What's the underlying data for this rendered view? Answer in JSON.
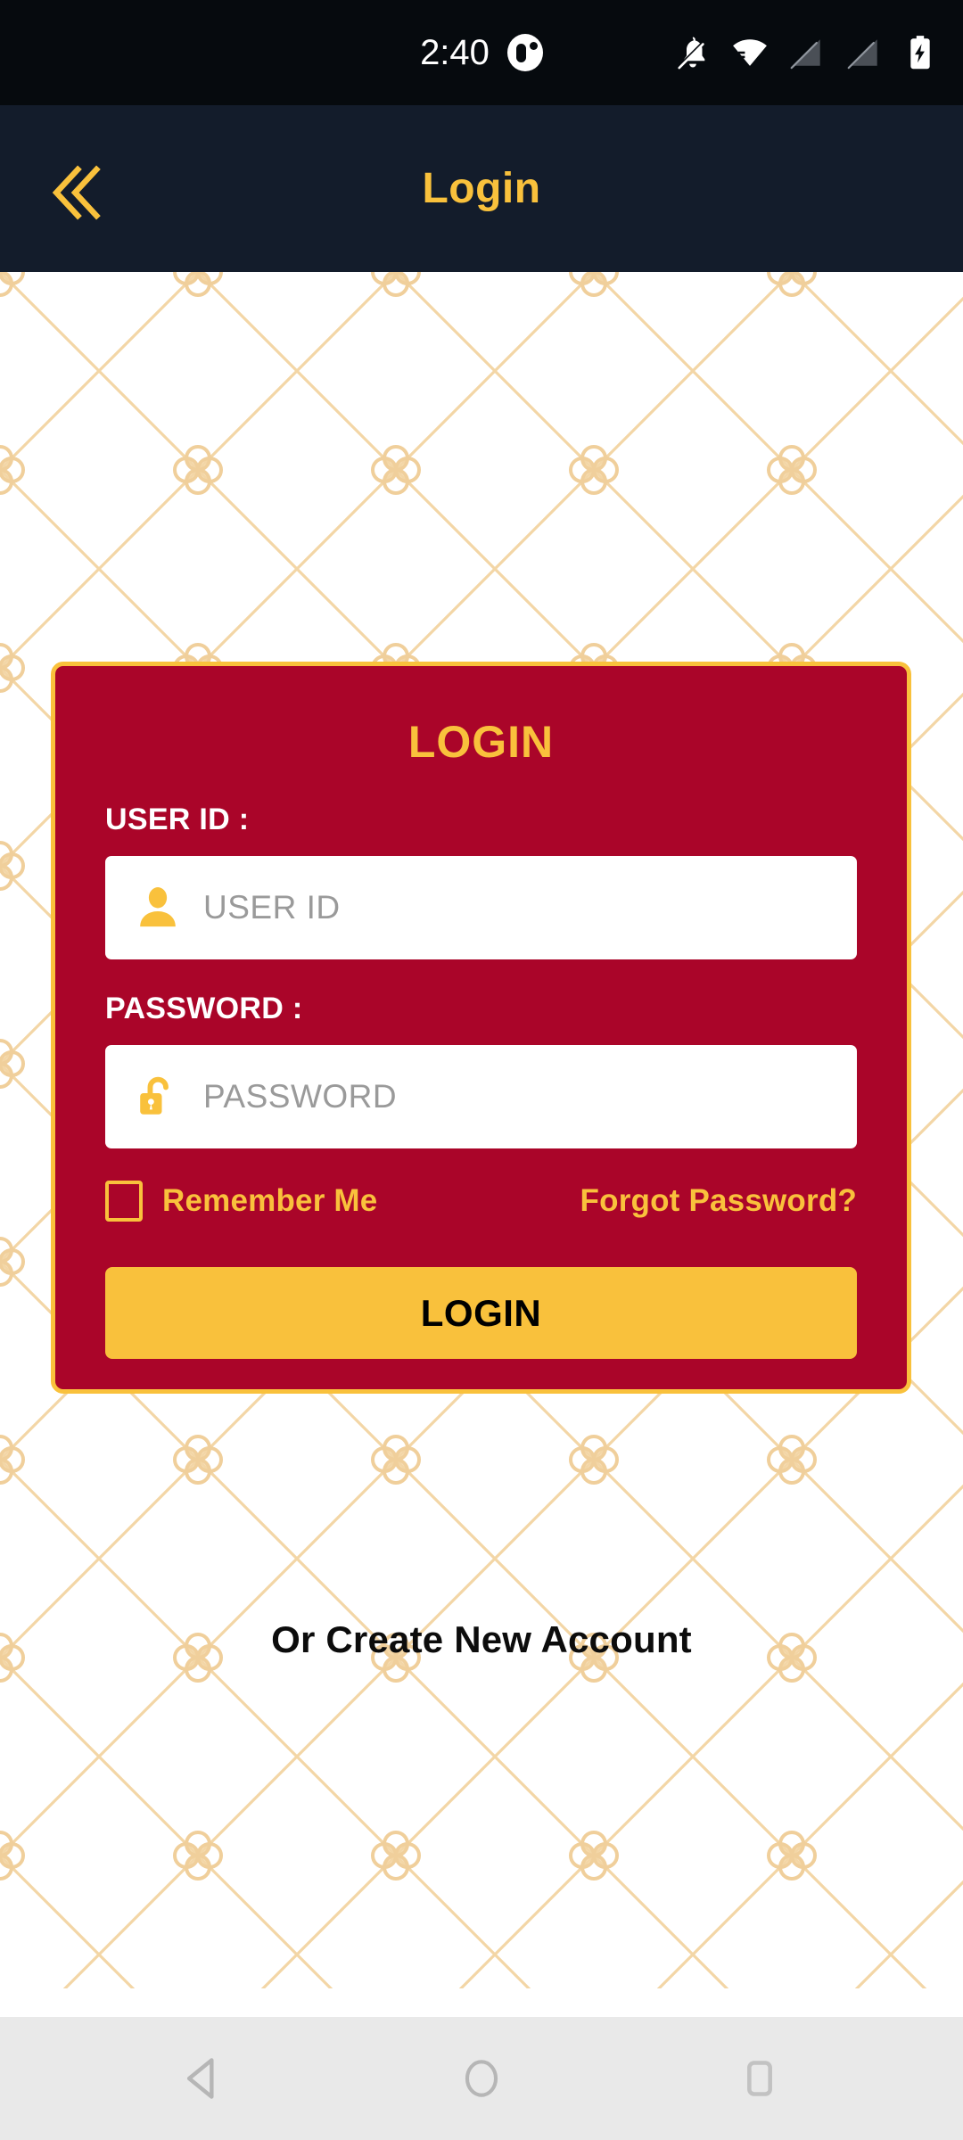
{
  "status_bar": {
    "time": "2:40",
    "notification_badge_icon": "notification-dot-icon",
    "icons": [
      "bell-off-icon",
      "wifi-icon",
      "no-sim-1-icon",
      "no-sim-2-icon",
      "battery-charging-icon"
    ]
  },
  "app_bar": {
    "title": "Login",
    "back_icon": "double-chevron-left-icon",
    "background_color": "#131C2B",
    "accent_color": "#F9C13C"
  },
  "login_card": {
    "title": "LOGIN",
    "background_color": "#AA0529",
    "border_color": "#F9C13C",
    "userid": {
      "label": "USER ID :",
      "placeholder": "USER ID",
      "value": "",
      "icon": "user-icon"
    },
    "password": {
      "label": "PASSWORD :",
      "placeholder": "PASSWORD",
      "value": "",
      "icon": "unlock-icon"
    },
    "remember_me": {
      "label": "Remember Me",
      "checked": false
    },
    "forgot_password": "Forgot Password?",
    "submit_button": "LOGIN"
  },
  "create_account": "Or Create New Account",
  "nav_bar": {
    "back_icon": "triangle-back-icon",
    "home_icon": "circle-home-icon",
    "recents_icon": "square-recents-icon",
    "background_color": "#E9E9E9"
  },
  "theme": {
    "gold": "#F9C13C",
    "crimson": "#AA0529",
    "dark_navy": "#131C2B",
    "status_black": "#060A0E",
    "pattern_gold": "#F2D3A0"
  }
}
